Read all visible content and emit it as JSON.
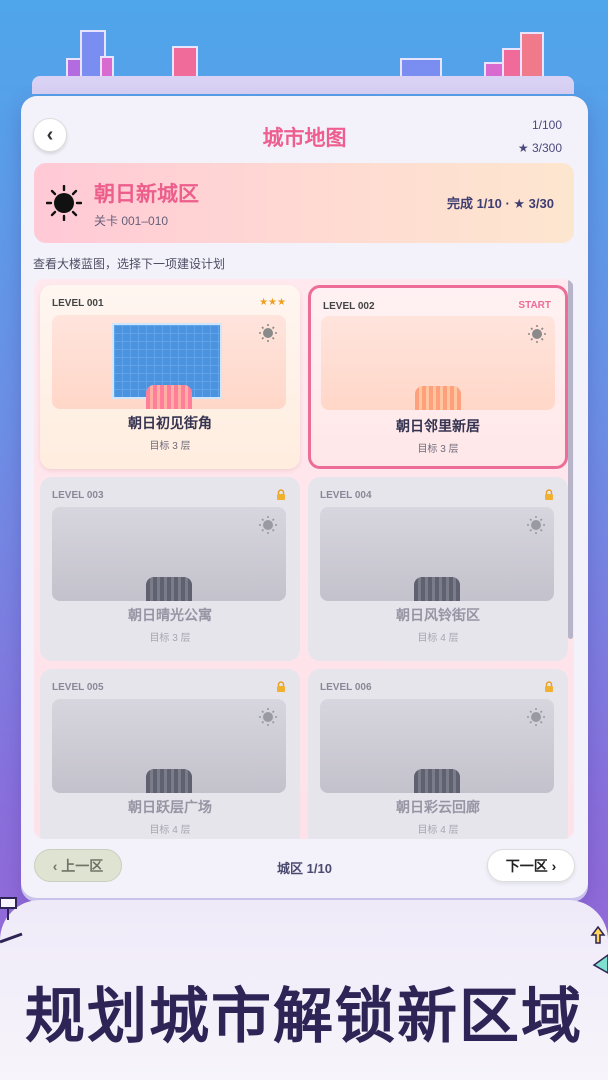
{
  "header": {
    "title": "城市地图",
    "back_label": "‹",
    "level_progress": "1/100",
    "stars_progress": "★ 3/300"
  },
  "district": {
    "name": "朝日新城区",
    "range": "关卡 001–010",
    "stats": "完成 1/10 · ★ 3/30"
  },
  "hint": "查看大楼蓝图，选择下一项建设计划",
  "levels": [
    {
      "code": "LEVEL 001",
      "tag": "★★★",
      "name": "朝日初见街角",
      "goal": "目标 3 层",
      "state": "open"
    },
    {
      "code": "LEVEL 002",
      "tag": "START",
      "name": "朝日邻里新居",
      "goal": "目标 3 层",
      "state": "start"
    },
    {
      "code": "LEVEL 003",
      "tag": "",
      "name": "朝日晴光公寓",
      "goal": "目标 3 层",
      "state": "locked"
    },
    {
      "code": "LEVEL 004",
      "tag": "",
      "name": "朝日风铃街区",
      "goal": "目标 4 层",
      "state": "locked"
    },
    {
      "code": "LEVEL 005",
      "tag": "",
      "name": "朝日跃层广场",
      "goal": "目标 4 层",
      "state": "locked"
    },
    {
      "code": "LEVEL 006",
      "tag": "",
      "name": "朝日彩云回廊",
      "goal": "目标 4 层",
      "state": "locked"
    }
  ],
  "footer": {
    "prev_label": "‹ 上一区",
    "page": "城区 1/10",
    "next_label": "下一区 ›"
  },
  "promo": "规划城市解锁新区域",
  "colors": {
    "accent_pink": "#ec5e8c",
    "star_gold": "#f0a020",
    "start_pink": "#ec6d98",
    "text_dark": "#2e2456"
  }
}
